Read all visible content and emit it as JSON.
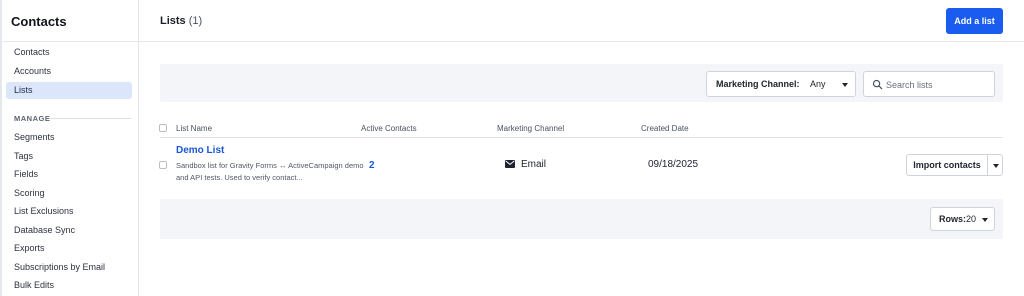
{
  "sidebar": {
    "title": "Contacts",
    "items": [
      {
        "label": "Contacts"
      },
      {
        "label": "Accounts"
      },
      {
        "label": "Lists",
        "active": true
      }
    ],
    "section_label": "MANAGE",
    "manage_items": [
      {
        "label": "Segments"
      },
      {
        "label": "Tags"
      },
      {
        "label": "Fields"
      },
      {
        "label": "Scoring"
      },
      {
        "label": "List Exclusions"
      },
      {
        "label": "Database Sync"
      },
      {
        "label": "Exports"
      },
      {
        "label": "Subscriptions by Email"
      },
      {
        "label": "Bulk Edits"
      }
    ]
  },
  "header": {
    "title": "Lists",
    "count": "(1)",
    "add_button": "Add a list"
  },
  "filters": {
    "channel_label": "Marketing Channel:",
    "channel_value": "Any",
    "search_placeholder": "Search lists",
    "search_icon": "search-icon"
  },
  "table": {
    "columns": [
      "List Name",
      "Active Contacts",
      "Marketing Channel",
      "Created Date"
    ],
    "rows": [
      {
        "name": "Demo List",
        "description": "Sandbox list for Gravity Forms ↔ ActiveCampaign demo and API tests. Used to verify contact...",
        "active_contacts": "2",
        "channel": "Email",
        "channel_icon": "envelope-icon",
        "created": "09/18/2025",
        "action": "Import contacts"
      }
    ]
  },
  "footer": {
    "rows_label": "Rows:",
    "rows_value": "20"
  },
  "colors": {
    "primary": "#1a5cf0",
    "link": "#1a56d6",
    "active_nav": "#dbe6fb"
  }
}
